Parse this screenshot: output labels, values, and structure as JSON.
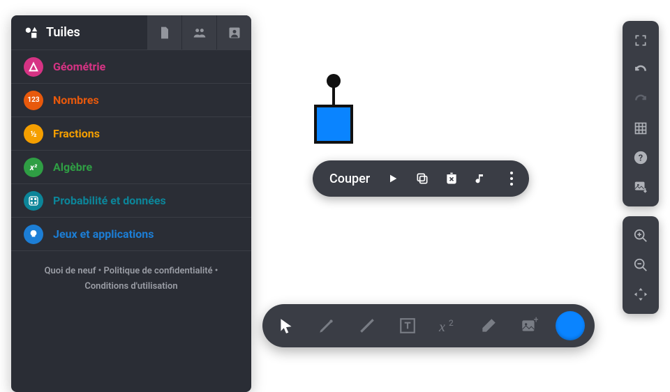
{
  "sidebar": {
    "title": "Tuiles",
    "categories": [
      {
        "label": "Géométrie",
        "color": "#d63384",
        "badge_bg": "#d63384",
        "icon": "triangle"
      },
      {
        "label": "Nombres",
        "color": "#e8590c",
        "badge_bg": "#e8590c",
        "icon": "123"
      },
      {
        "label": "Fractions",
        "color": "#f59f00",
        "badge_bg": "#f59f00",
        "icon": "half"
      },
      {
        "label": "Algèbre",
        "color": "#2f9e44",
        "badge_bg": "#2f9e44",
        "icon": "x2"
      },
      {
        "label": "Probabilité et données",
        "color": "#0c8599",
        "badge_bg": "#0c8599",
        "icon": "dice"
      },
      {
        "label": "Jeux et applications",
        "color": "#1c7ed6",
        "badge_bg": "#1c7ed6",
        "icon": "bulb"
      }
    ],
    "footer_line1": "Quoi de neuf  •  Politique de confidentialité  •",
    "footer_line2": "Conditions d'utilisation"
  },
  "context_menu": {
    "label": "Couper"
  },
  "colors": {
    "accent": "#0a84ff"
  }
}
